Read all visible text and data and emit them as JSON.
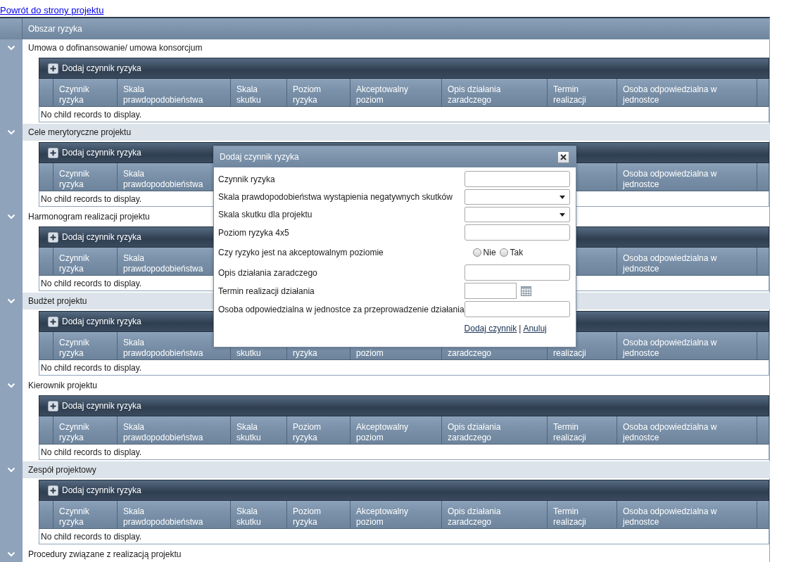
{
  "back_link": "Powrót do strony projektu",
  "grid": {
    "column_header": "Obszar ryzyka",
    "groups": [
      {
        "title": "Umowa o dofinansowanie/ umowa konsorcjum",
        "expanded": true,
        "add_button": "Dodaj czynnik ryzyka",
        "columns": [
          {
            "label": "Czynnik ryzyka"
          },
          {
            "label": "Skala prawdopodobieństwa"
          },
          {
            "label": "Skala skutku"
          },
          {
            "label": "Poziom ryzyka"
          },
          {
            "label": "Akceptowalny poziom"
          },
          {
            "label": "Opis działania zaradczego"
          },
          {
            "label": "Termin realizacji"
          },
          {
            "label": "Osoba odpowiedzialna w jednostce"
          }
        ],
        "empty_text": "No child records to display."
      },
      {
        "title": "Cele merytoryczne projektu",
        "expanded": true,
        "add_button": "Dodaj czynnik ryzyka",
        "columns": [
          {
            "label": "Czynnik ryzyka"
          },
          {
            "label": "Skala prawdopodobieństwa"
          },
          {},
          {},
          {},
          {},
          {},
          {
            "label": "Osoba odpowiedzialna w jednostce"
          }
        ],
        "empty_text": "No child records to display."
      },
      {
        "title": "Harmonogram realizacji projektu",
        "expanded": true,
        "add_button": "Dodaj czynnik ryzyka",
        "columns": [
          {
            "label": "Czynnik ryzyka"
          },
          {
            "label": "Skala prawdopodobieństwa"
          },
          {},
          {},
          {},
          {},
          {},
          {
            "label": "Osoba odpowiedzialna w jednostce"
          }
        ],
        "empty_text": "No child records to display."
      },
      {
        "title": "Budżet projektu",
        "expanded": true,
        "add_button": "Dodaj czynnik ryzyka",
        "columns": [
          {
            "label": "Czynnik ryzyka"
          },
          {
            "label": "Skala prawdopodobieństwa"
          },
          {
            "label": "skutku"
          },
          {
            "label": "ryzyka"
          },
          {
            "label": "poziom"
          },
          {
            "label": "zaradczego"
          },
          {
            "label": "realizacji"
          },
          {
            "label": "Osoba odpowiedzialna w jednostce"
          }
        ],
        "empty_text": "No child records to display."
      },
      {
        "title": "Kierownik projektu",
        "expanded": true,
        "add_button": "Dodaj czynnik ryzyka",
        "columns": [
          {
            "label": "Czynnik ryzyka"
          },
          {
            "label": "Skala prawdopodobieństwa"
          },
          {
            "label": "Skala skutku"
          },
          {
            "label": "Poziom ryzyka"
          },
          {
            "label": "Akceptowalny poziom"
          },
          {
            "label": "Opis działania zaradczego"
          },
          {
            "label": "Termin realizacji"
          },
          {
            "label": "Osoba odpowiedzialna w jednostce"
          }
        ],
        "empty_text": "No child records to display."
      },
      {
        "title": "Zespół projektowy",
        "expanded": true,
        "add_button": "Dodaj czynnik ryzyka",
        "columns": [
          {
            "label": "Czynnik ryzyka"
          },
          {
            "label": "Skala prawdopodobieństwa"
          },
          {
            "label": "Skala skutku"
          },
          {
            "label": "Poziom ryzyka"
          },
          {
            "label": "Akceptowalny poziom"
          },
          {
            "label": "Opis działania zaradczego"
          },
          {
            "label": "Termin realizacji"
          },
          {
            "label": "Osoba odpowiedzialna w jednostce"
          }
        ],
        "empty_text": "No child records to display."
      },
      {
        "title": "Procedury związane z realizacją projektu",
        "expanded": true
      }
    ]
  },
  "dialog": {
    "title": "Dodaj czynnik ryzyka",
    "fields": [
      {
        "kind": "text",
        "label": "Czynnik ryzyka"
      },
      {
        "kind": "select",
        "label": "Skala prawdopodobieństwa wystąpienia negatywnych skutków"
      },
      {
        "kind": "select",
        "label": "Skala skutku dla projektu"
      },
      {
        "kind": "text",
        "label": "Poziom ryzyka 4x5"
      },
      {
        "kind": "radio",
        "label": "Czy ryzyko jest na akceptowalnym poziomie",
        "options": [
          {
            "label": "Nie",
            "selected": false
          },
          {
            "label": "Tak",
            "selected": false
          }
        ]
      },
      {
        "kind": "text",
        "label": "Opis działania zaradczego"
      },
      {
        "kind": "date",
        "label": "Termin realizacji działania"
      },
      {
        "kind": "text",
        "label": "Osoba odpowiedzialna w jednostce za przeprowadzenie działania"
      }
    ],
    "submit_link": "Dodaj czynnik",
    "separator": "|",
    "cancel_link": "Anuluj"
  }
}
